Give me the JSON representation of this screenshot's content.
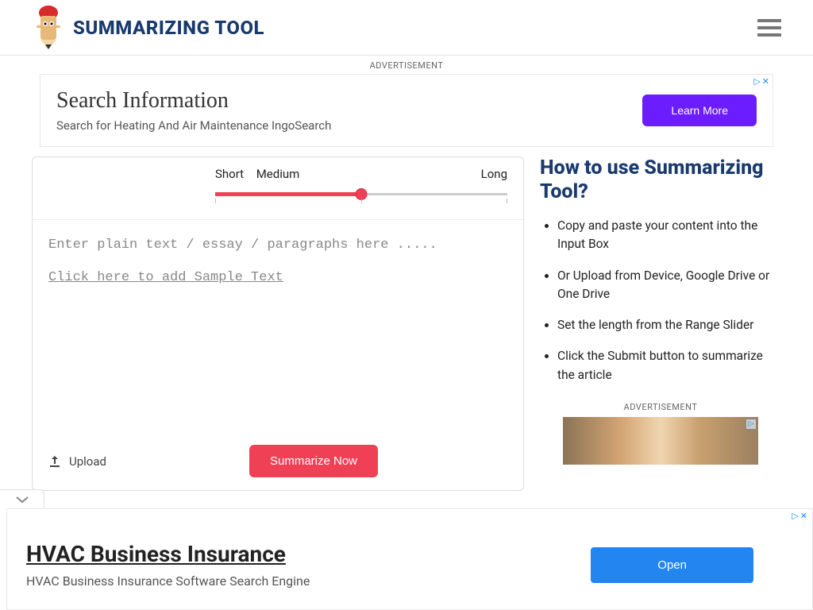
{
  "header": {
    "title": "SUMMARIZING TOOL"
  },
  "ad_label": "ADVERTISEMENT",
  "top_ad": {
    "title": "Search Information",
    "desc": "Search for Heating And Air Maintenance IngoSearch",
    "button": "Learn More"
  },
  "slider": {
    "short": "Short",
    "medium": "Medium",
    "long": "Long",
    "value": 50
  },
  "editor": {
    "placeholder": "Enter plain text / essay / paragraphs here .....",
    "sample_link": "Click here to add Sample Text"
  },
  "actions": {
    "upload": "Upload",
    "summarize": "Summarize Now"
  },
  "howto": {
    "title": "How to use Summarizing Tool?",
    "items": [
      "Copy and paste your content into the Input Box",
      "Or Upload from Device, Google Drive or One Drive",
      "Set the length from the Range Slider",
      "Click the Submit button to summarize the article"
    ]
  },
  "bottom_ad": {
    "title": "HVAC Business Insurance",
    "desc": "HVAC Business Insurance Software Search Engine",
    "button": "Open"
  },
  "ad_info_x": "✕",
  "ad_info_i": "▷"
}
